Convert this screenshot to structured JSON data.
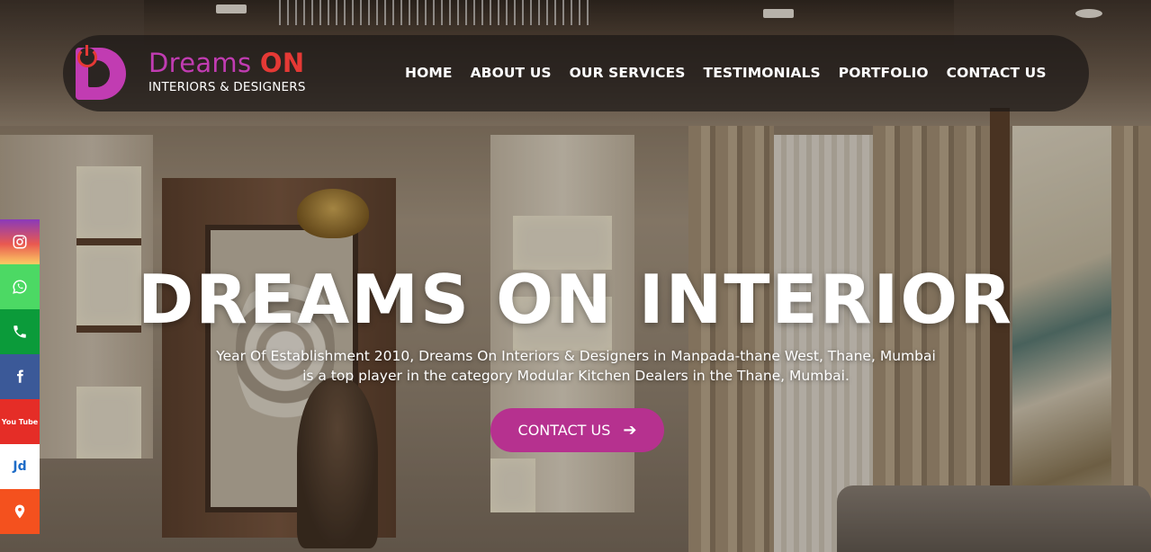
{
  "brand": {
    "name_part1": "Dreams ",
    "name_part2": "ON",
    "tagline": "INTERIORS & DESIGNERS",
    "primary_color": "#c13cb2",
    "accent_color": "#e53935"
  },
  "nav": {
    "items": [
      {
        "label": "HOME"
      },
      {
        "label": "ABOUT US"
      },
      {
        "label": "OUR SERVICES"
      },
      {
        "label": "TESTIMONIALS"
      },
      {
        "label": "PORTFOLIO"
      },
      {
        "label": "CONTACT US"
      }
    ]
  },
  "hero": {
    "title": "DREAMS ON INTERIOR",
    "description": "Year Of Establishment 2010, Dreams On Interiors & Designers in Manpada-thane West, Thane, Mumbai is a top player in the category Modular Kitchen Dealers in the Thane, Mumbai.",
    "cta_label": "CONTACT US",
    "cta_color": "#b6318f"
  },
  "social": {
    "items": [
      {
        "icon": "instagram-icon"
      },
      {
        "icon": "whatsapp-icon"
      },
      {
        "icon": "phone-icon"
      },
      {
        "icon": "facebook-icon"
      },
      {
        "icon": "youtube-icon",
        "label": "You Tube"
      },
      {
        "icon": "justdial-icon",
        "label": "Jd"
      },
      {
        "icon": "location-pin-icon"
      }
    ]
  }
}
